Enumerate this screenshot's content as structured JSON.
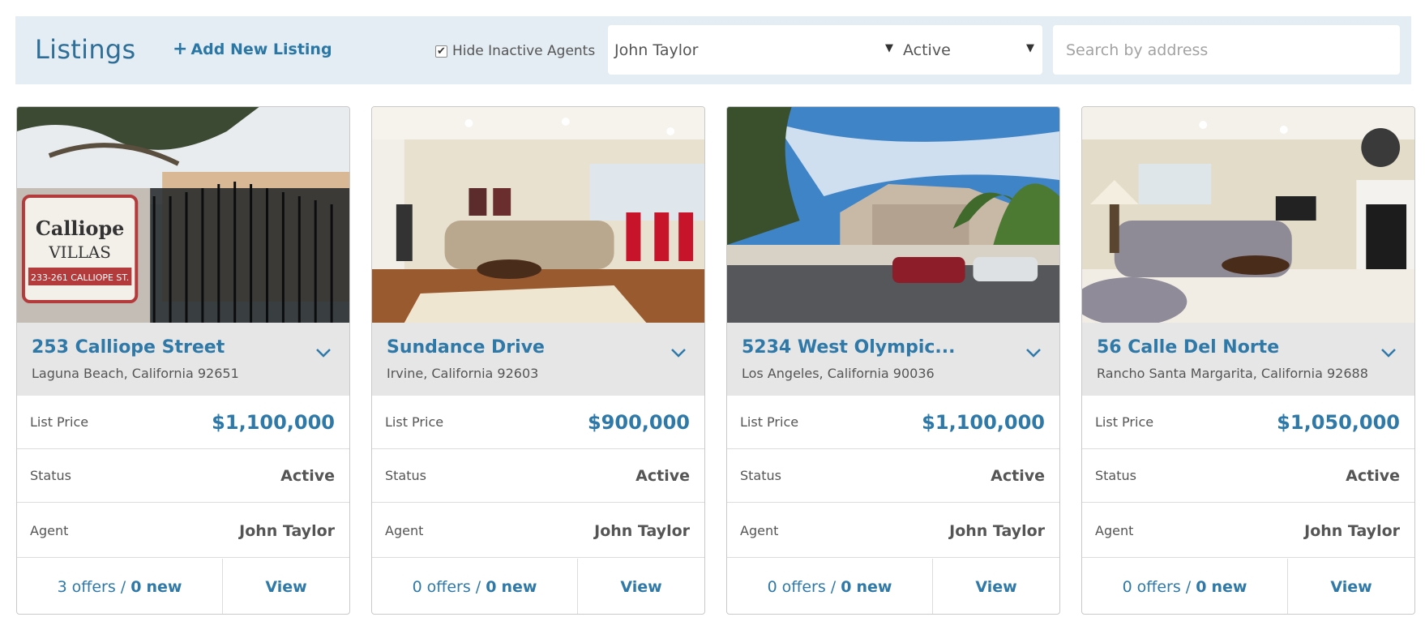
{
  "header": {
    "title": "Listings",
    "add_label": "Add New Listing",
    "hide_inactive_label": "Hide Inactive Agents",
    "hide_inactive_checked": true,
    "agent_select": "John Taylor",
    "status_select": "Active",
    "search_placeholder": "Search by address"
  },
  "labels": {
    "list_price": "List Price",
    "status": "Status",
    "agent": "Agent",
    "offers_suffix": "offers /",
    "new_suffix": "new",
    "view": "View"
  },
  "colors": {
    "accent": "#2f79a8",
    "header_bg": "#e4edf3",
    "card_head_bg": "#e6e6e6"
  },
  "listings": [
    {
      "street": "253 Calliope Street",
      "city": "Laguna Beach, California 92651",
      "price": "$1,100,000",
      "status": "Active",
      "agent": "John Taylor",
      "offers": "3",
      "new": "0",
      "photo": "gate-sign-photo"
    },
    {
      "street": "Sundance Drive",
      "city": "Irvine, California 92603",
      "price": "$900,000",
      "status": "Active",
      "agent": "John Taylor",
      "offers": "0",
      "new": "0",
      "photo": "living-room-photo"
    },
    {
      "street": "5234 West Olympic...",
      "city": "Los Angeles, California 90036",
      "price": "$1,100,000",
      "status": "Active",
      "agent": "John Taylor",
      "offers": "0",
      "new": "0",
      "photo": "street-exterior-photo"
    },
    {
      "street": "56 Calle Del Norte",
      "city": "Rancho Santa Margarita, California 92688",
      "price": "$1,050,000",
      "status": "Active",
      "agent": "John Taylor",
      "offers": "0",
      "new": "0",
      "photo": "living-room-photo-2"
    }
  ]
}
